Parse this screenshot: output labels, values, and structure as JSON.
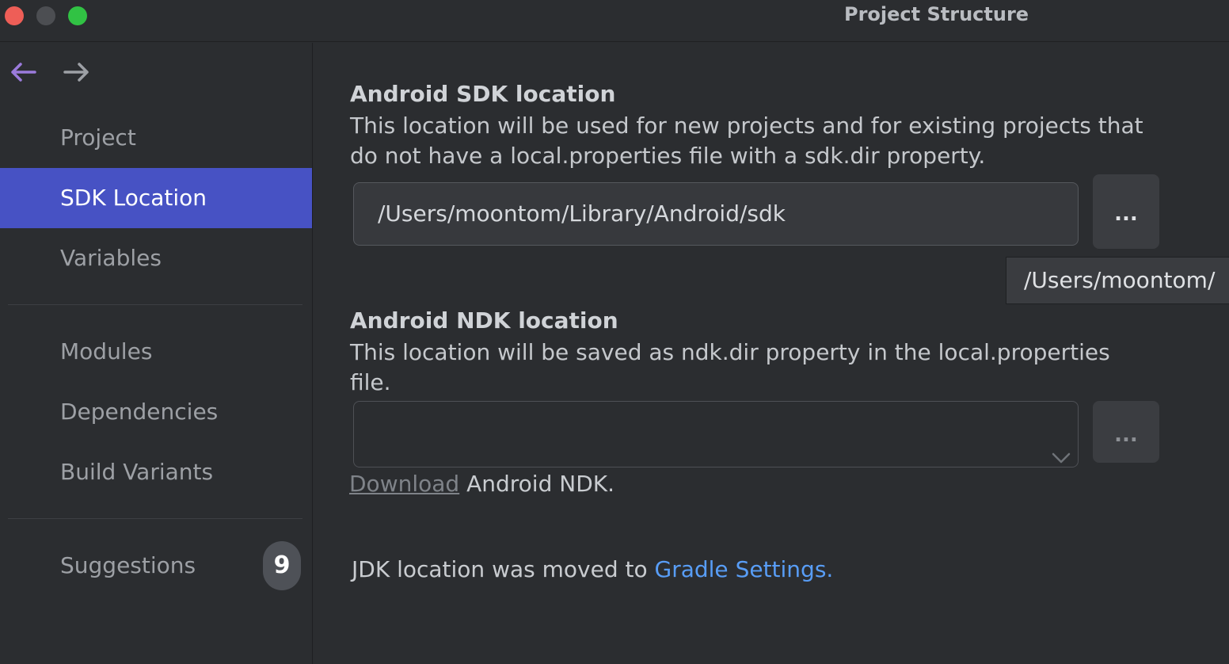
{
  "window": {
    "title": "Project Structure",
    "colors": {
      "close": "#ee5e57",
      "minimize": "#4c4e52",
      "maximize": "#31c244"
    }
  },
  "sidebar": {
    "nav": {
      "back_icon": "arrow-left-icon",
      "forward_icon": "arrow-right-icon",
      "back_color": "#9b7bdc"
    },
    "items": [
      {
        "label": "Project"
      },
      {
        "label": "SDK Location",
        "selected": true
      },
      {
        "label": "Variables"
      },
      {
        "label": "Modules"
      },
      {
        "label": "Dependencies"
      },
      {
        "label": "Build Variants"
      },
      {
        "label": "Suggestions",
        "badge": "9"
      }
    ],
    "selected_color": "#4752c4"
  },
  "sdk": {
    "title": "Android SDK location",
    "description": "This location will be used for new projects and for existing projects that do not have a local.properties file with a sdk.dir property.",
    "path_value": "/Users/moontom/Library/Android/sdk",
    "browse_label": "...",
    "tooltip": "/Users/moontom/"
  },
  "ndk": {
    "title": "Android NDK location",
    "description": "This location will be saved as ndk.dir property in the local.properties file.",
    "path_value": "",
    "browse_label": "...",
    "download_link": "Download",
    "download_suffix": " Android NDK."
  },
  "jdk": {
    "text": "JDK location was moved to ",
    "link": "Gradle Settings.",
    "link_color": "#589df6"
  }
}
